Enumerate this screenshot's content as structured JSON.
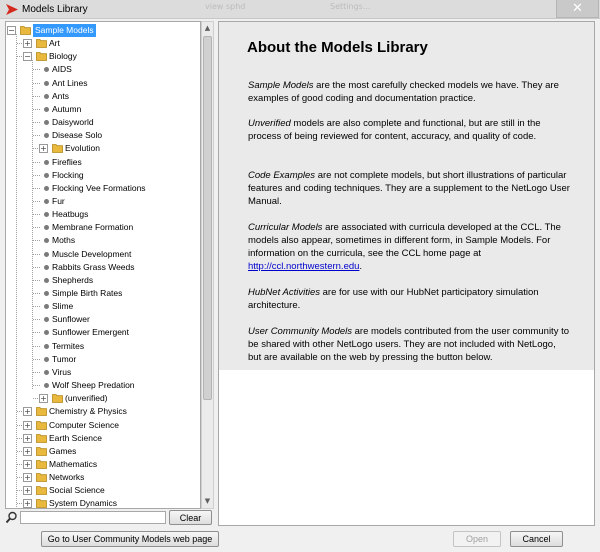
{
  "window": {
    "title": "Models Library",
    "faded_bg_1": "view sphd",
    "faded_bg_2": "Settings...",
    "close_glyph": "✕"
  },
  "tree": {
    "nodes": [
      {
        "label": "Sample Models",
        "depth": 0,
        "kind": "folder",
        "expanded": true,
        "selected": true
      },
      {
        "label": "Art",
        "depth": 1,
        "kind": "folder",
        "expanded": false
      },
      {
        "label": "Biology",
        "depth": 1,
        "kind": "folder",
        "expanded": true
      },
      {
        "label": "AIDS",
        "depth": 2,
        "kind": "leaf"
      },
      {
        "label": "Ant Lines",
        "depth": 2,
        "kind": "leaf"
      },
      {
        "label": "Ants",
        "depth": 2,
        "kind": "leaf"
      },
      {
        "label": "Autumn",
        "depth": 2,
        "kind": "leaf"
      },
      {
        "label": "Daisyworld",
        "depth": 2,
        "kind": "leaf"
      },
      {
        "label": "Disease Solo",
        "depth": 2,
        "kind": "leaf"
      },
      {
        "label": "Evolution",
        "depth": 2,
        "kind": "folder",
        "expanded": false
      },
      {
        "label": "Fireflies",
        "depth": 2,
        "kind": "leaf"
      },
      {
        "label": "Flocking",
        "depth": 2,
        "kind": "leaf"
      },
      {
        "label": "Flocking Vee Formations",
        "depth": 2,
        "kind": "leaf"
      },
      {
        "label": "Fur",
        "depth": 2,
        "kind": "leaf"
      },
      {
        "label": "Heatbugs",
        "depth": 2,
        "kind": "leaf"
      },
      {
        "label": "Membrane Formation",
        "depth": 2,
        "kind": "leaf"
      },
      {
        "label": "Moths",
        "depth": 2,
        "kind": "leaf"
      },
      {
        "label": "Muscle Development",
        "depth": 2,
        "kind": "leaf"
      },
      {
        "label": "Rabbits Grass Weeds",
        "depth": 2,
        "kind": "leaf"
      },
      {
        "label": "Shepherds",
        "depth": 2,
        "kind": "leaf"
      },
      {
        "label": "Simple Birth Rates",
        "depth": 2,
        "kind": "leaf"
      },
      {
        "label": "Slime",
        "depth": 2,
        "kind": "leaf"
      },
      {
        "label": "Sunflower",
        "depth": 2,
        "kind": "leaf"
      },
      {
        "label": "Sunflower Emergent",
        "depth": 2,
        "kind": "leaf"
      },
      {
        "label": "Termites",
        "depth": 2,
        "kind": "leaf"
      },
      {
        "label": "Tumor",
        "depth": 2,
        "kind": "leaf"
      },
      {
        "label": "Virus",
        "depth": 2,
        "kind": "leaf"
      },
      {
        "label": "Wolf Sheep Predation",
        "depth": 2,
        "kind": "leaf"
      },
      {
        "label": "(unverified)",
        "depth": 2,
        "kind": "folder",
        "expanded": false
      },
      {
        "label": "Chemistry & Physics",
        "depth": 1,
        "kind": "folder",
        "expanded": false
      },
      {
        "label": "Computer Science",
        "depth": 1,
        "kind": "folder",
        "expanded": false
      },
      {
        "label": "Earth Science",
        "depth": 1,
        "kind": "folder",
        "expanded": false
      },
      {
        "label": "Games",
        "depth": 1,
        "kind": "folder",
        "expanded": false
      },
      {
        "label": "Mathematics",
        "depth": 1,
        "kind": "folder",
        "expanded": false
      },
      {
        "label": "Networks",
        "depth": 1,
        "kind": "folder",
        "expanded": false
      },
      {
        "label": "Social Science",
        "depth": 1,
        "kind": "folder",
        "expanded": false
      },
      {
        "label": "System Dynamics",
        "depth": 1,
        "kind": "folder",
        "expanded": false
      }
    ]
  },
  "search": {
    "value": "",
    "clear_label": "Clear"
  },
  "info": {
    "heading": "About the Models Library",
    "p1_em": "Sample Models",
    "p1_rest": " are the most carefully checked models we have. They are examples of good coding and documentation practice.",
    "p2_em": "Unverified",
    "p2_rest": " models are also complete and functional, but are still in the process of being reviewed for content, accuracy, and quality of code.",
    "p3_em": "Code Examples",
    "p3_rest": " are not complete models, but short illustrations of particular features and coding techniques. They are a supplement to the NetLogo User Manual.",
    "p4_em": "Curricular Models",
    "p4_rest": " are associated with curricula developed at the CCL. The models also appear, sometimes in different form, in Sample Models. For information on the curricula, see the CCL home page at ",
    "p4_link": "http://ccl.northwestern.edu",
    "p4_end": ".",
    "p5_em": "HubNet Activities",
    "p5_rest": " are for use with our HubNet participatory simulation architecture.",
    "p6_em": "User Community Models",
    "p6_rest": " are models contributed from the user community to be shared with other NetLogo users. They are not included with NetLogo, but are available on the web by pressing the button below."
  },
  "buttons": {
    "community": "Go to User Community Models web page",
    "open": "Open",
    "cancel": "Cancel"
  },
  "colors": {
    "selection": "#3399ff",
    "folder": "#e8b93c",
    "link": "#0000cc"
  }
}
